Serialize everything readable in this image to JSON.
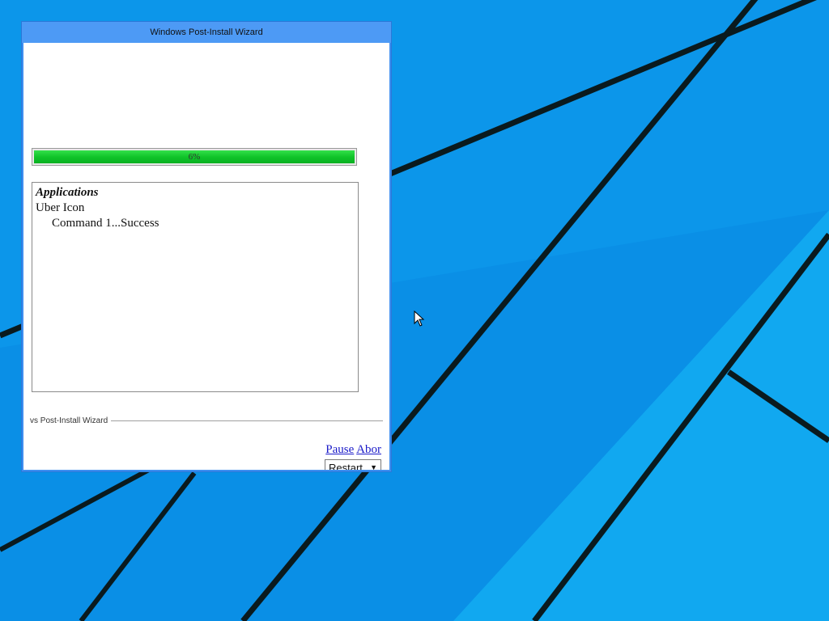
{
  "window": {
    "title": "Windows Post-Install Wizard",
    "progress": {
      "percent": 6,
      "label": "6%"
    },
    "log": {
      "heading": "Applications",
      "lines": [
        {
          "text": "Uber Icon",
          "indent": 0
        },
        {
          "text": "Command 1...Success",
          "indent": 1
        }
      ]
    },
    "footer": {
      "label": "vs Post-Install Wizard",
      "pause_label": "Pause",
      "abort_label": "Abor",
      "restart_label": "Restart"
    }
  },
  "colors": {
    "desktop": "#0a8fe6",
    "titlebar": "#4d9af5",
    "progress_fill": "#11c42a"
  }
}
